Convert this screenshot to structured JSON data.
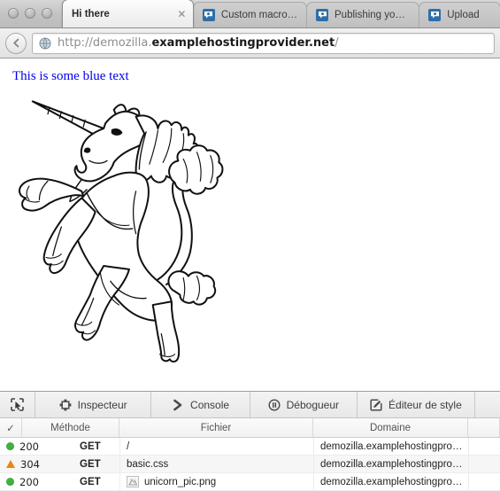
{
  "window": {
    "controls": [
      "close",
      "minimize",
      "zoom"
    ]
  },
  "tabs": [
    {
      "label": "Hi there",
      "active": true,
      "favicon": "none",
      "close_glyph": "✕"
    },
    {
      "label": "Custom macros...",
      "active": false,
      "favicon": "mdn-icon"
    },
    {
      "label": "Publishing your...",
      "active": false,
      "favicon": "mdn-icon"
    },
    {
      "label": "Upload",
      "active": false,
      "favicon": "mdn-icon"
    }
  ],
  "navbar": {
    "back_icon": "back-arrow-icon",
    "site_icon": "globe-icon",
    "url_prefix": "http://demozilla.",
    "url_host": "examplehostingprovider.net",
    "url_suffix": "/"
  },
  "page": {
    "heading": "This is some blue text",
    "heading_color": "#0000ee",
    "image_alt": "unicorn_pic.png"
  },
  "devtools": {
    "pick_icon": "element-picker-icon",
    "tabs": [
      {
        "label": "Inspecteur",
        "icon": "inspector-icon"
      },
      {
        "label": "Console",
        "icon": "chevron-right-icon"
      },
      {
        "label": "Débogueur",
        "icon": "pause-circle-icon"
      },
      {
        "label": "Éditeur de style",
        "icon": "style-editor-icon"
      }
    ],
    "network": {
      "columns": [
        {
          "key": "status",
          "label": "✓"
        },
        {
          "key": "method",
          "label": "Méthode"
        },
        {
          "key": "file",
          "label": "Fichier"
        },
        {
          "key": "domain",
          "label": "Domaine"
        }
      ],
      "rows": [
        {
          "status_icon": "green-circle-icon",
          "status_color": "#3fb23f",
          "code": "200",
          "method": "GET",
          "file": "/",
          "file_thumb": false,
          "domain": "demozilla.examplehostingpro…"
        },
        {
          "status_icon": "orange-triangle-icon",
          "status_color": "#e8870e",
          "code": "304",
          "method": "GET",
          "file": "basic.css",
          "file_thumb": false,
          "domain": "demozilla.examplehostingpro…"
        },
        {
          "status_icon": "green-circle-icon",
          "status_color": "#3fb23f",
          "code": "200",
          "method": "GET",
          "file": "unicorn_pic.png",
          "file_thumb": true,
          "domain": "demozilla.examplehostingpro…"
        }
      ]
    }
  }
}
